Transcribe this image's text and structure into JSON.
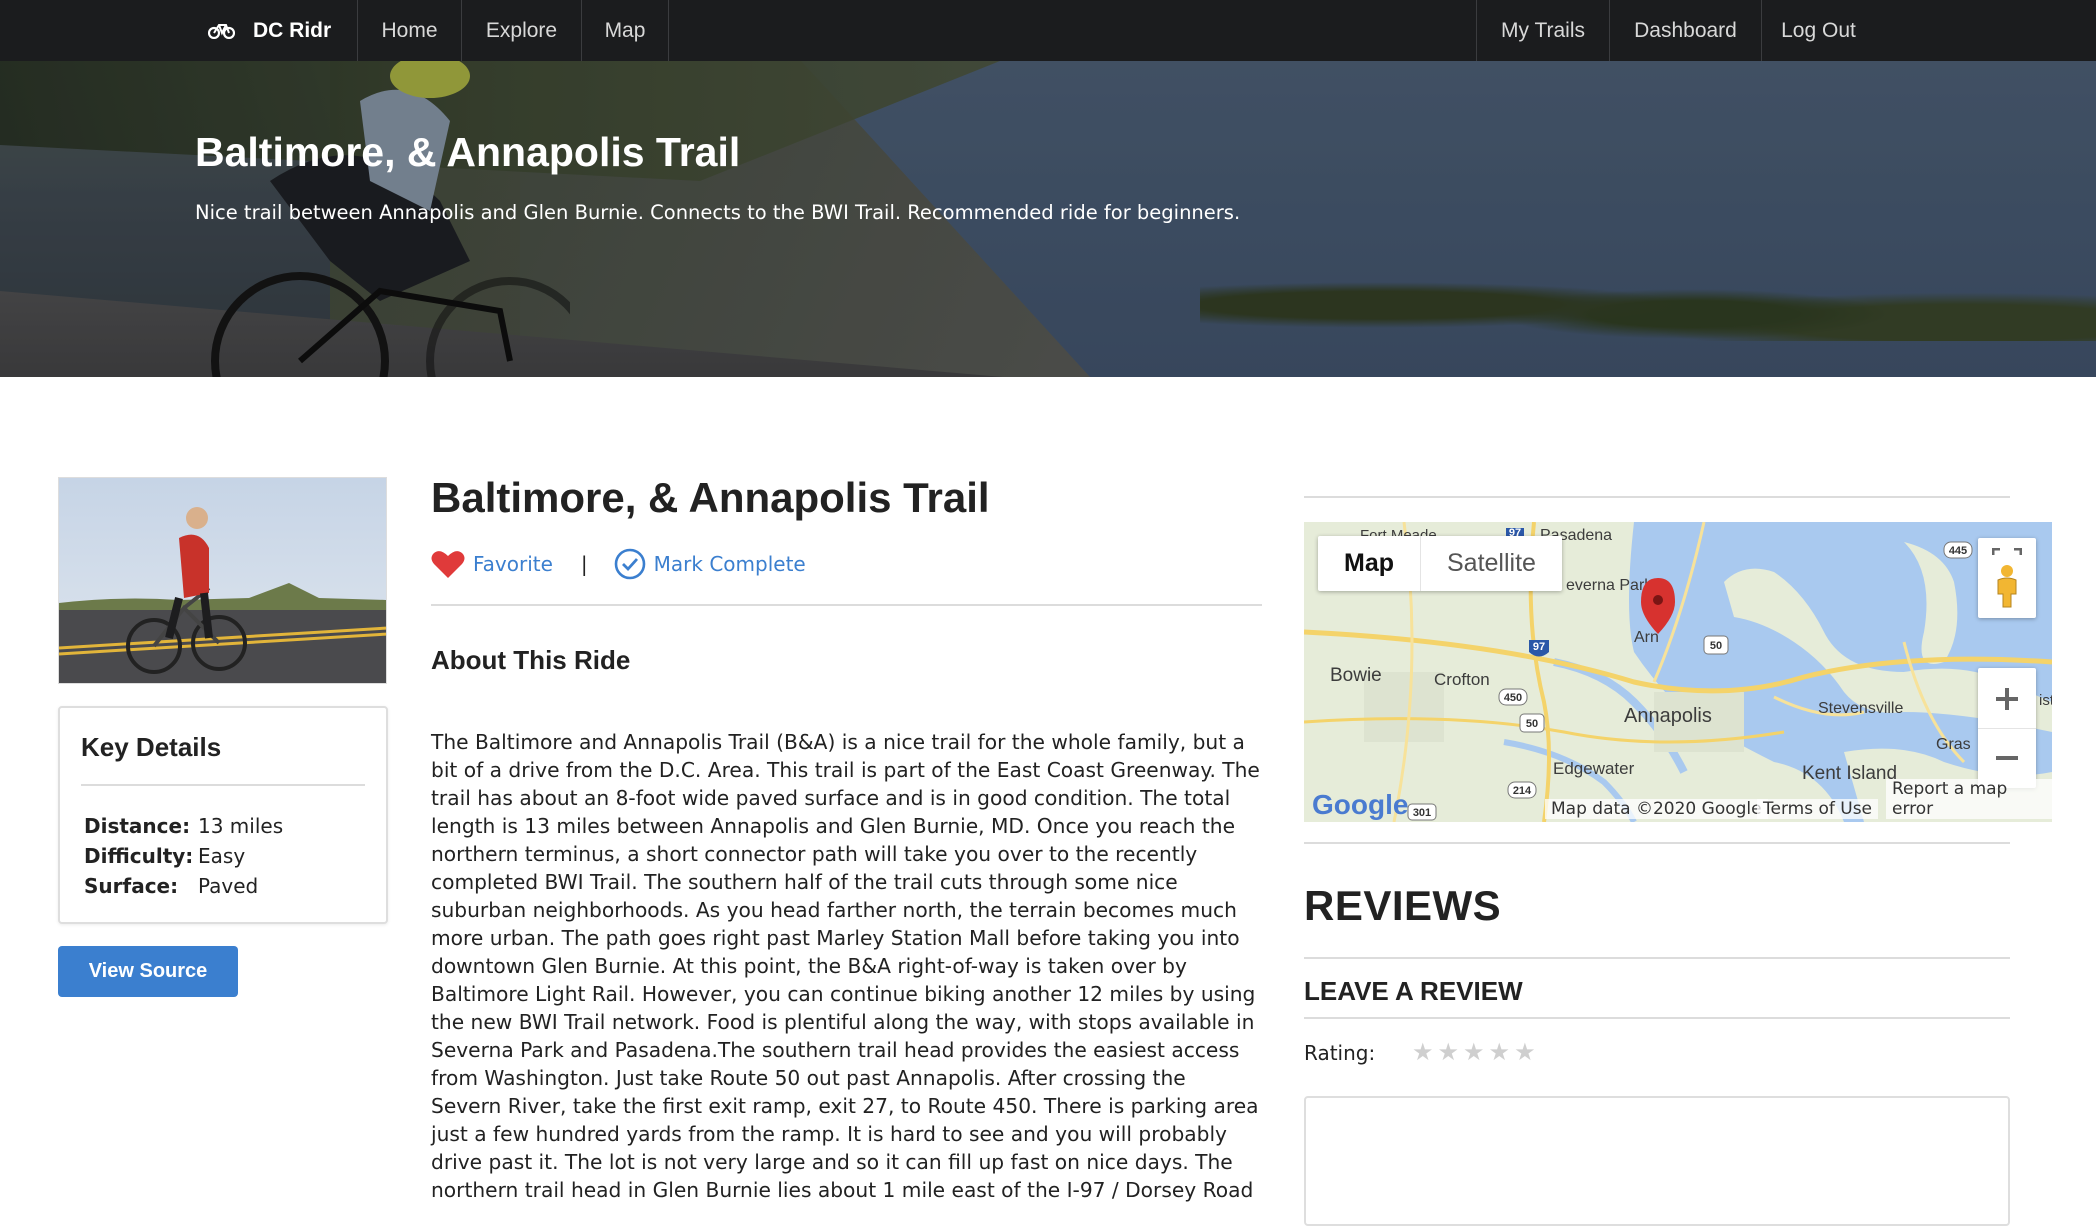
{
  "nav": {
    "brand": "DC Ridr",
    "left_items": [
      "Home",
      "Explore",
      "Map"
    ],
    "right_items": [
      "My Trails",
      "Dashboard",
      "Log Out"
    ]
  },
  "hero": {
    "title": "Baltimore, & Annapolis Trail",
    "subtitle": "Nice trail between Annapolis and Glen Burnie. Connects to the BWI Trail. Recommended ride for beginners."
  },
  "key_details": {
    "heading": "Key Details",
    "rows": [
      {
        "label": "Distance:",
        "value": "13 miles"
      },
      {
        "label": "Difficulty:",
        "value": "Easy"
      },
      {
        "label": "Surface:",
        "value": "Paved"
      }
    ]
  },
  "view_source_label": "View Source",
  "trail": {
    "title": "Baltimore, & Annapolis Trail",
    "favorite_label": "Favorite",
    "separator": "|",
    "complete_label": "Mark Complete",
    "about_heading": "About This Ride",
    "about_text": "The Baltimore and Annapolis Trail (B&A) is a nice trail for the whole family, but a bit of a drive from the D.C. Area. This trail is part of the East Coast Greenway. The trail has about an 8-foot wide paved surface and is in good condition. The total length is 13 miles between Annapolis and Glen Burnie, MD. Once you reach the northern terminus, a short connector path will take you over to the recently completed BWI Trail. The southern half of the trail cuts through some nice suburban neighborhoods. As you head farther north, the terrain becomes much more urban. The path goes right past Marley Station Mall before taking you into downtown Glen Burnie. At this point, the B&A right-of-way is taken over by Baltimore Light Rail. However, you can continue biking another 12 miles by using the new BWI Trail network. Food is plentiful along the way, with stops available in Severna Park and Pasadena.The southern trail head provides the easiest access from Washington. Just take Route 50 out past Annapolis. After crossing the Severn River, take the first exit ramp, exit 27, to Route 450. There is parking area just a few hundred yards from the ramp. It is hard to see and you will probably drive past it. The lot is not very large and so it can fill up fast on nice days. The northern trail head in Glen Burnie lies about 1 mile east of the I-97 / Dorsey Road"
  },
  "map": {
    "type_buttons": [
      "Map",
      "Satellite"
    ],
    "selected_type": "Map",
    "place_labels": [
      "Pasadena",
      "everna Park",
      "Arn",
      "Bowie",
      "Crofton",
      "Annapolis",
      "Stevensville",
      "Gras",
      "Kent Island",
      "Edgewater",
      "ist",
      "Fort Meade"
    ],
    "shields": [
      "97",
      "97",
      "450",
      "50",
      "50",
      "214",
      "301",
      "445"
    ],
    "logo": "Google",
    "attribution": "Map data ©2020 Google",
    "terms": "Terms of Use",
    "report": "Report a map error"
  },
  "reviews": {
    "heading": "REVIEWS",
    "leave_heading": "LEAVE A REVIEW",
    "rating_label": "Rating:",
    "rating_value": 0,
    "rating_max": 5
  },
  "colors": {
    "nav_bg": "#1b1c1e",
    "link_blue": "#3b7fcf",
    "heart_red": "#e03a3a"
  }
}
